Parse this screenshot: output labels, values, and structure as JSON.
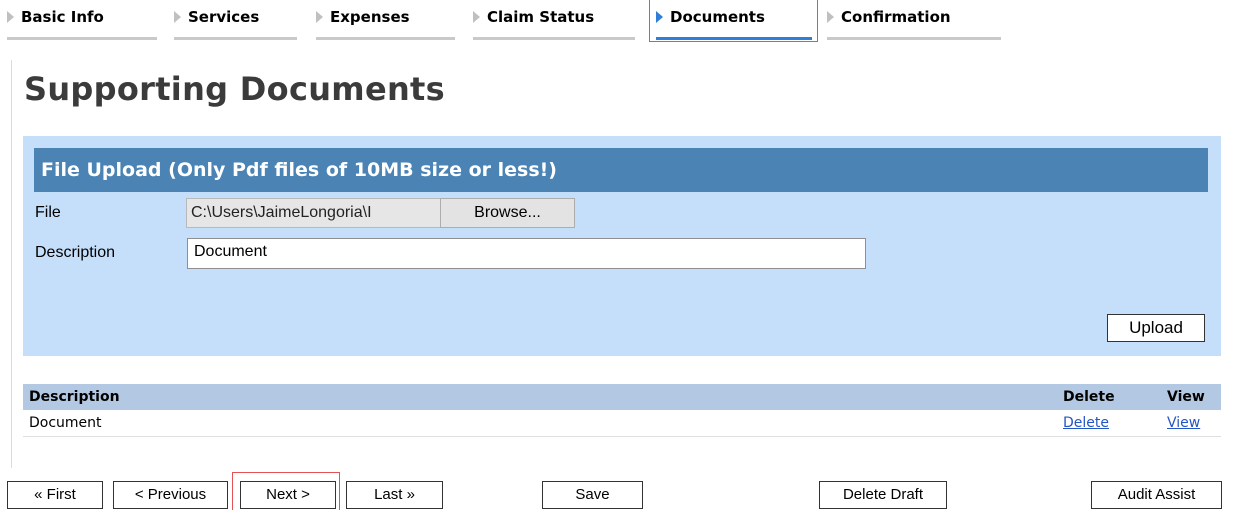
{
  "tabs": [
    {
      "label": "Basic Info"
    },
    {
      "label": "Services"
    },
    {
      "label": "Expenses"
    },
    {
      "label": "Claim Status"
    },
    {
      "label": "Documents",
      "active": true
    },
    {
      "label": "Confirmation"
    }
  ],
  "page_title": "Supporting Documents",
  "upload": {
    "header": "File Upload (Only Pdf files of 10MB size or less!)",
    "file_label": "File",
    "file_value": "C:\\Users\\JaimeLongoria\\I",
    "browse_label": "Browse...",
    "description_label": "Description",
    "description_value": "Document",
    "upload_label": "Upload"
  },
  "documents": {
    "columns": {
      "description": "Description",
      "delete": "Delete",
      "view": "View"
    },
    "rows": [
      {
        "description": "Document",
        "delete": "Delete",
        "view": "View"
      }
    ]
  },
  "nav_buttons": {
    "first": "« First",
    "previous": "< Previous",
    "next": "Next >",
    "last": "Last »",
    "save": "Save",
    "delete_draft": "Delete Draft",
    "audit_assist": "Audit Assist"
  },
  "colors": {
    "active_tab": "#2f7ed8",
    "panel_bg": "#c5dffb",
    "panel_header": "#4a83b4",
    "table_header": "#b3c8e2",
    "highlight": "#e45353",
    "link": "#2456c4"
  }
}
